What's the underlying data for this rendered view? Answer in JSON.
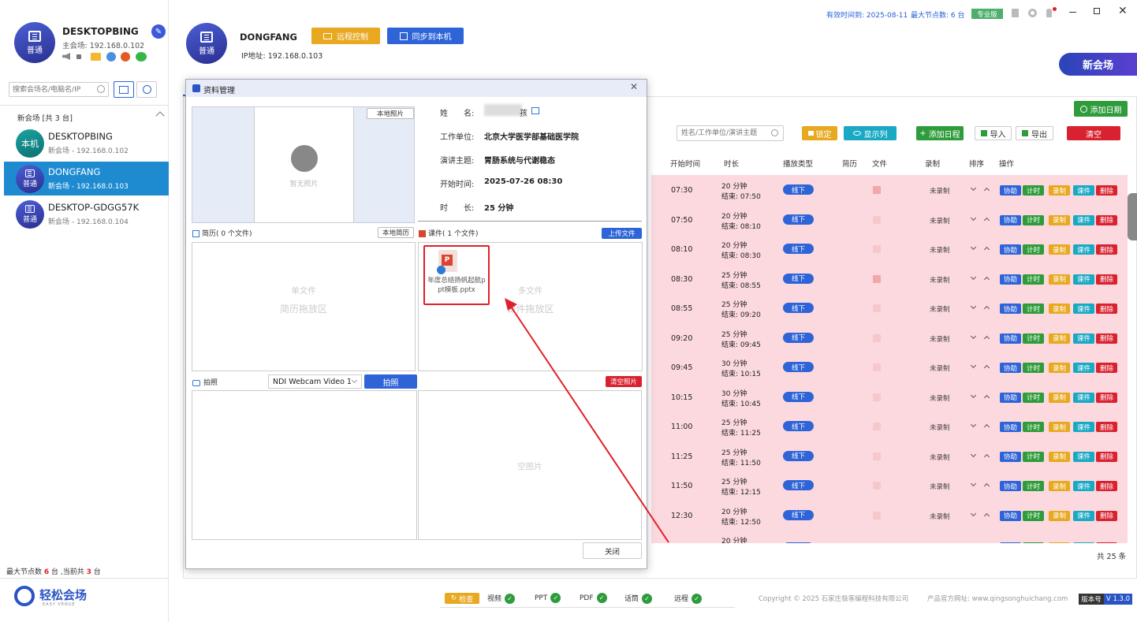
{
  "topbar": {
    "expiry": "有效时间到: 2025-08-11",
    "max_nodes": "最大节点数: 6 台",
    "edition": "专业版"
  },
  "sidebar": {
    "local": {
      "name": "DESKTOPBING",
      "sub": "主会场: 192.168.0.102",
      "badge": "普通"
    },
    "search_placeholder": "搜索会场名/电脑名/IP",
    "group": "新会场 [共 3 台]",
    "items": [
      {
        "avatar": "本机",
        "name": "DESKTOPBING",
        "ip": "新会场 - 192.168.0.102"
      },
      {
        "avatar": "普通",
        "name": "DONGFANG",
        "ip": "新会场 - 192.168.0.103"
      },
      {
        "avatar": "普通",
        "name": "DESKTOP-GDGG57K",
        "ip": "新会场 - 192.168.0.104"
      }
    ],
    "footer": {
      "p1": "最大节点数",
      "n1": "6",
      "p2": "台 ,当前共",
      "n2": "3",
      "p3": "台"
    },
    "logo": "轻松会场",
    "logo_sub": "EASY VENUE"
  },
  "header": {
    "name": "DONGFANG",
    "badge": "普通",
    "ip": "IP地址: 192.168.0.103",
    "remote_btn": "远程控制",
    "sync_btn": "同步到本机",
    "new_venue": "新会场"
  },
  "toolbar": {
    "add_date": "添加日期",
    "search_placeholder": "姓名/工作单位/演讲主题",
    "lock": "锁定",
    "show_cols": "显示列",
    "add_schedule": "添加日程",
    "import": "导入",
    "export": "导出",
    "clear": "清空"
  },
  "table": {
    "headers": [
      "开始时间",
      "时长",
      "播放类型",
      "简历",
      "文件",
      "录制",
      "排序",
      "操作"
    ],
    "rows": [
      {
        "start": "07:30",
        "dur": "20 分钟",
        "end": "结束: 07:50",
        "file": true
      },
      {
        "start": "07:50",
        "dur": "20 分钟",
        "end": "结束: 08:10",
        "file": false
      },
      {
        "start": "08:10",
        "dur": "20 分钟",
        "end": "结束: 08:30",
        "file": false
      },
      {
        "start": "08:30",
        "dur": "25 分钟",
        "end": "结束: 08:55",
        "file": true
      },
      {
        "start": "08:55",
        "dur": "25 分钟",
        "end": "结束: 09:20",
        "file": false
      },
      {
        "start": "09:20",
        "dur": "25 分钟",
        "end": "结束: 09:45",
        "file": false
      },
      {
        "start": "09:45",
        "dur": "30 分钟",
        "end": "结束: 10:15",
        "file": false
      },
      {
        "start": "10:15",
        "dur": "30 分钟",
        "end": "结束: 10:45",
        "file": false
      },
      {
        "start": "11:00",
        "dur": "25 分钟",
        "end": "结束: 11:25",
        "file": false
      },
      {
        "start": "11:25",
        "dur": "25 分钟",
        "end": "结束: 11:50",
        "file": false
      },
      {
        "start": "11:50",
        "dur": "25 分钟",
        "end": "结束: 12:15",
        "file": false
      },
      {
        "start": "12:30",
        "dur": "20 分钟",
        "end": "结束: 12:50",
        "file": false
      }
    ],
    "partial_dur": "20 分钟",
    "play_type": "线下",
    "record": "未录制",
    "actions": [
      "协助",
      "计时",
      "录制",
      "课件",
      "删除"
    ],
    "total": "共 25 条"
  },
  "dialog": {
    "title": "资料管理",
    "no_photo": "暂无照片",
    "local_photo": "本地照片",
    "name_label": "姓　　名:",
    "name_suffix": "孩",
    "unit_label": "工作单位:",
    "unit": "北京大学医学部基础医学院",
    "topic_label": "演讲主题:",
    "topic": "胃肠系统与代谢稳态",
    "start_label": "开始时间:",
    "start": "2025-07-26 08:30",
    "dur_label": "时　　长:",
    "dur": "25 分钟",
    "resume_title": "简历( 0 个文件)",
    "local_resume": "本地简历",
    "resume_drop1": "单文件",
    "resume_drop2": "简历拖放区",
    "course_title": "课件( 1 个文件)",
    "upload": "上传文件",
    "course_drop1": "多文件",
    "course_drop2": "课件拖放区",
    "file_name": "年度总结扬帆起航ppt模板.pptx",
    "photo_title": "拍照",
    "camera": "NDI Webcam Video 1",
    "shoot": "拍照",
    "clear_photo": "清空照片",
    "empty_pic": "空图片",
    "close": "关闭"
  },
  "statusbar": {
    "check": "检查",
    "items": [
      "视频",
      "PPT",
      "PDF",
      "话筒",
      "远程"
    ],
    "copyright": "Copyright © 2025 石家庄极客编程科技有限公司",
    "site": "产品官方网址: www.qingsonghuichang.com",
    "version_label": "版本号",
    "version": "V 1.3.0"
  }
}
